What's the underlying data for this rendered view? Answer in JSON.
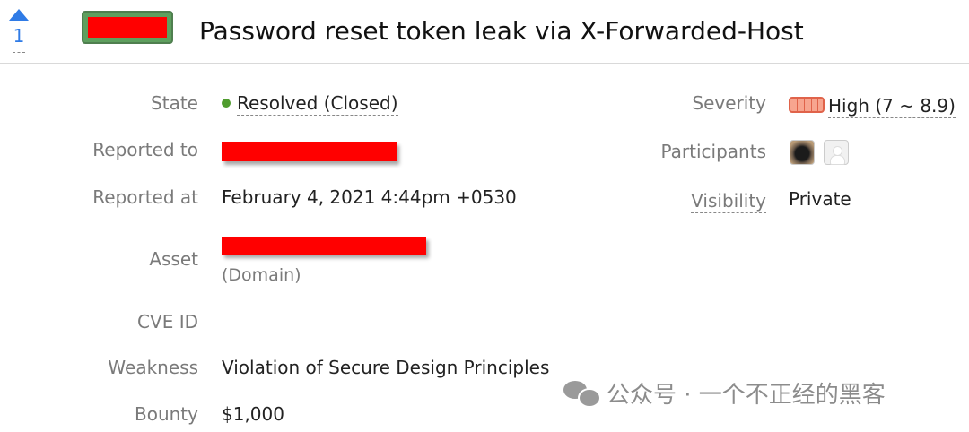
{
  "report": {
    "vote_count": "1",
    "title": "Password reset token leak via X-Forwarded-Host"
  },
  "fields": {
    "state_label": "State",
    "state_value": "Resolved (Closed)",
    "reported_to_label": "Reported to",
    "reported_at_label": "Reported at",
    "reported_at_value": "February 4, 2021 4:44pm +0530",
    "asset_label": "Asset",
    "asset_type": "(Domain)",
    "cve_label": "CVE ID",
    "weakness_label": "Weakness",
    "weakness_value": "Violation of Secure Design Principles",
    "bounty_label": "Bounty",
    "bounty_value": "$1,000",
    "severity_label": "Severity",
    "severity_value": "High (7 ~ 8.9)",
    "participants_label": "Participants",
    "visibility_label": "Visibility",
    "visibility_value": "Private"
  },
  "icons": {
    "vote": "upvote-arrow-icon",
    "status": "status-dot-icon",
    "severity": "severity-meter-icon",
    "participant_1": "participant-avatar-icon",
    "participant_2": "default-avatar-icon",
    "watermark": "wechat-logo-icon"
  },
  "colors": {
    "accent_blue": "#2f7be6",
    "status_green": "#4f9c2e",
    "severity_high": "#e0634a",
    "redaction": "#ff0000"
  },
  "watermark": {
    "text": "公众号 · 一个不正经的黑客"
  }
}
